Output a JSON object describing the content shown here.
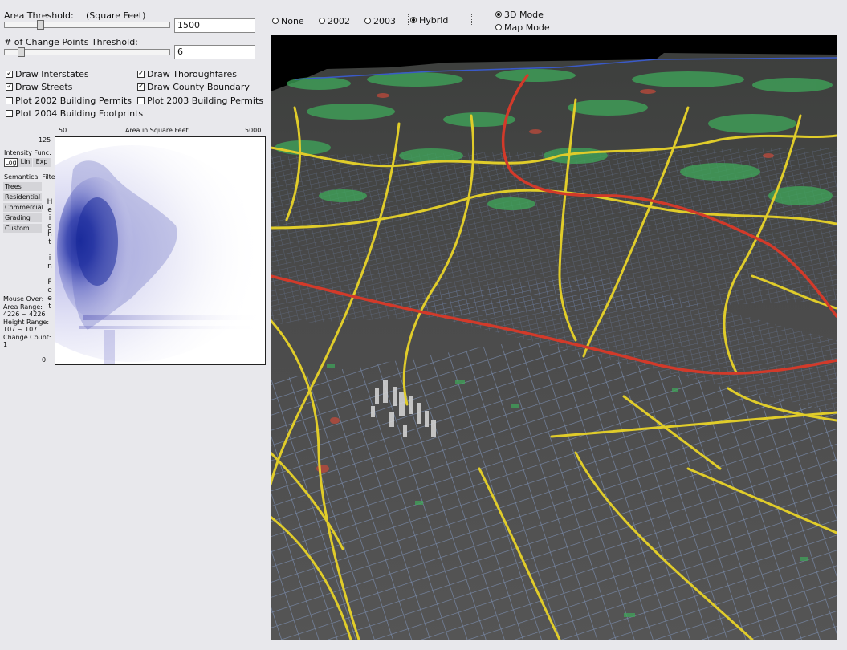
{
  "controls": {
    "area_threshold": {
      "label": "Area Threshold:",
      "unit": "(Square Feet)",
      "value": "1500"
    },
    "change_points_threshold": {
      "label": "# of Change Points Threshold:",
      "value": "6"
    },
    "checkboxes": [
      {
        "label": "Draw Interstates",
        "checked": true
      },
      {
        "label": "Draw Thoroughfares",
        "checked": true
      },
      {
        "label": "Draw Streets",
        "checked": true
      },
      {
        "label": "Draw County Boundary",
        "checked": true
      },
      {
        "label": "Plot 2002 Building Permits",
        "checked": false
      },
      {
        "label": "Plot 2003 Building Permits",
        "checked": false
      },
      {
        "label": "Plot 2004 Building Footprints",
        "checked": false
      }
    ]
  },
  "plot": {
    "x_min": "50",
    "x_title": "Area in Square Feet",
    "x_max": "5000",
    "y_max": "125",
    "y_min": "0",
    "y_title_chars": [
      "H",
      "e",
      "i",
      "g",
      "h",
      "t",
      "",
      "i",
      "n",
      "",
      "F",
      "e",
      "e",
      "t"
    ],
    "intensity_label": "Intensity Func:",
    "intensity_options": [
      "Log",
      "Lin",
      "Exp"
    ],
    "intensity_selected": "Log",
    "semantical_label": "Semantical Filter",
    "filters": [
      "Trees",
      "Residential",
      "Commercial",
      "Grading",
      "Custom"
    ],
    "mouse_over": {
      "title": "Mouse Over:",
      "area_label": "Area Range:",
      "area_value": "4226 ~ 4226",
      "height_label": "Height Range:",
      "height_value": "107 ~ 107",
      "count_label": "Change Count:",
      "count_value": "1"
    },
    "density_color": "#1a2a9a"
  },
  "toolbar": {
    "layers": [
      "None",
      "2002",
      "2003",
      "Hybrid"
    ],
    "layer_selected": "Hybrid",
    "modes": [
      "3D Mode",
      "Map Mode"
    ],
    "mode_selected": "3D Mode"
  },
  "map_colors": {
    "terrain": "#4a4a4a",
    "streets": "#7f93b8",
    "thoroughfares": "#e0cc2a",
    "interstates": "#d23a2a",
    "vegetation": "#3fa85a"
  }
}
